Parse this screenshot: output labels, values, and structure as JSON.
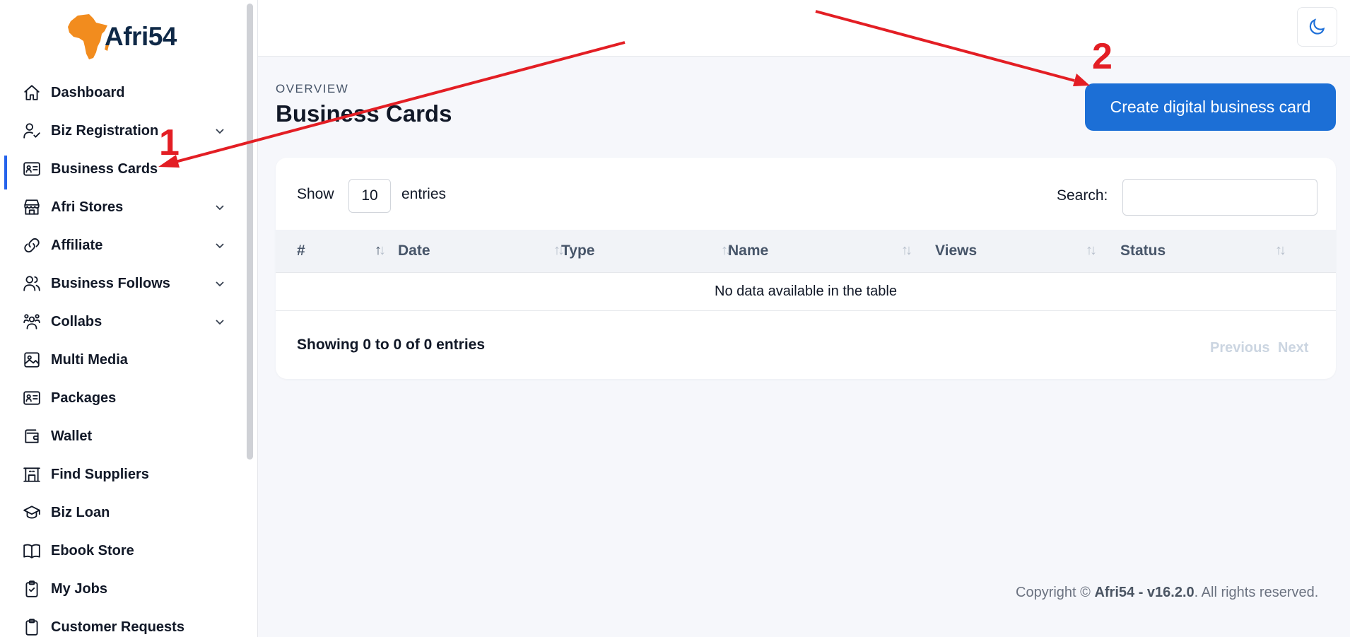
{
  "brand": {
    "name": "Afri54"
  },
  "sidebar": {
    "items": [
      {
        "label": "Dashboard",
        "icon": "home-icon",
        "chevron": false
      },
      {
        "label": "Biz Registration",
        "icon": "user-check-icon",
        "chevron": true
      },
      {
        "label": "Business Cards",
        "icon": "id-card-icon",
        "chevron": false,
        "active": true
      },
      {
        "label": "Afri Stores",
        "icon": "store-icon",
        "chevron": true
      },
      {
        "label": "Affiliate",
        "icon": "link-icon",
        "chevron": true
      },
      {
        "label": "Business Follows",
        "icon": "users-icon",
        "chevron": true
      },
      {
        "label": "Collabs",
        "icon": "group-icon",
        "chevron": true
      },
      {
        "label": "Multi Media",
        "icon": "image-icon",
        "chevron": false
      },
      {
        "label": "Packages",
        "icon": "id-card-icon",
        "chevron": false
      },
      {
        "label": "Wallet",
        "icon": "wallet-icon",
        "chevron": false
      },
      {
        "label": "Find Suppliers",
        "icon": "factory-icon",
        "chevron": false
      },
      {
        "label": "Biz Loan",
        "icon": "graduation-cap-icon",
        "chevron": false
      },
      {
        "label": "Ebook Store",
        "icon": "book-icon",
        "chevron": false
      },
      {
        "label": "My Jobs",
        "icon": "clipboard-check-icon",
        "chevron": false
      },
      {
        "label": "Customer Requests",
        "icon": "clipboard-icon",
        "chevron": false
      }
    ]
  },
  "header": {
    "overview": "OVERVIEW",
    "title": "Business Cards",
    "create_button": "Create digital business card"
  },
  "table": {
    "show_label": "Show",
    "page_length": "10",
    "entries_label": "entries",
    "search_label": "Search:",
    "search_value": "",
    "columns": [
      "#",
      "Date",
      "Type",
      "Name",
      "Views",
      "Status"
    ],
    "empty_message": "No data available in the table",
    "info": "Showing 0 to 0 of 0 entries",
    "previous": "Previous",
    "next": "Next"
  },
  "footer": {
    "prefix": "Copyright © ",
    "brand_version": "Afri54 - v16.2.0",
    "suffix": ". All rights reserved."
  },
  "annotations": {
    "step1": "1",
    "step2": "2",
    "color": "#e31e24"
  }
}
